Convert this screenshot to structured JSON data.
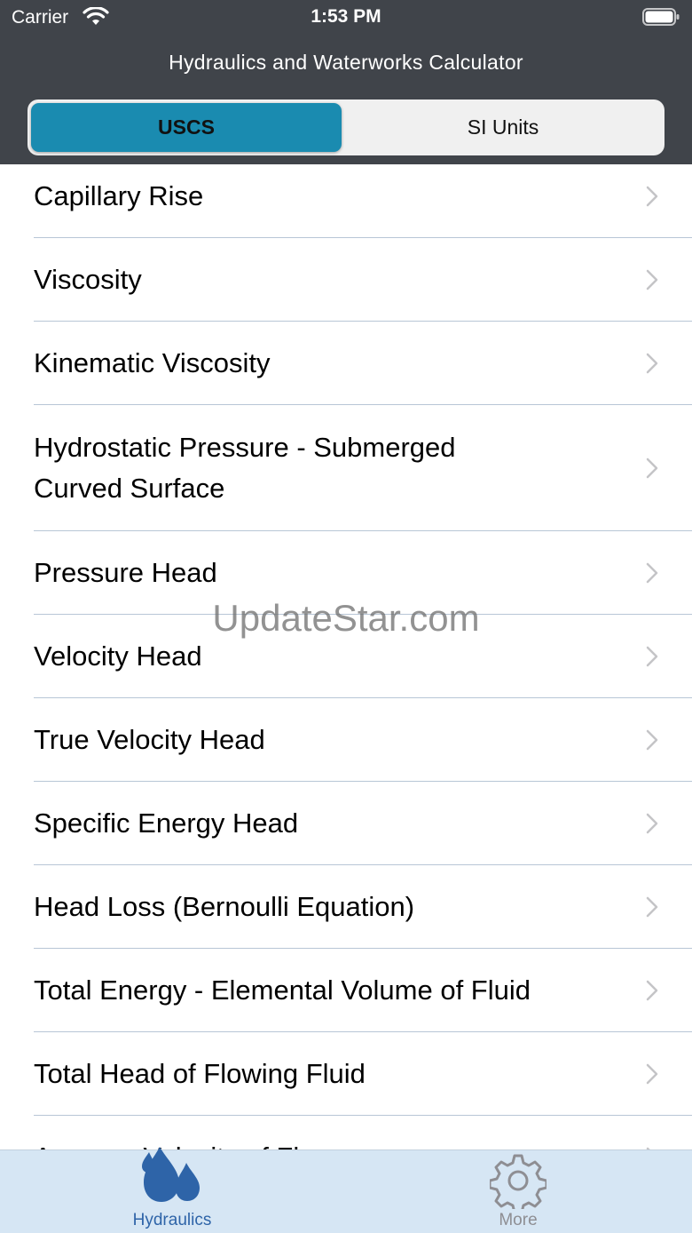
{
  "status_bar": {
    "carrier": "Carrier",
    "time": "1:53 PM"
  },
  "nav": {
    "title": "Hydraulics and Waterworks Calculator"
  },
  "segmented": {
    "options": [
      "USCS",
      "SI Units"
    ],
    "selected": "USCS"
  },
  "list": {
    "items": [
      {
        "label": "Capillary Rise"
      },
      {
        "label": "Viscosity"
      },
      {
        "label": "Kinematic Viscosity"
      },
      {
        "label": "Hydrostatic Pressure - Submerged Curved Surface"
      },
      {
        "label": "Pressure Head"
      },
      {
        "label": "Velocity Head"
      },
      {
        "label": "True Velocity Head"
      },
      {
        "label": "Specific Energy Head"
      },
      {
        "label": "Head Loss (Bernoulli Equation)"
      },
      {
        "label": "Total Energy - Elemental Volume of Fluid"
      },
      {
        "label": "Total Head of Flowing Fluid"
      },
      {
        "label": "Average Velocity of Flow"
      }
    ]
  },
  "watermark": "UpdateStar.com",
  "tab_bar": {
    "tabs": [
      {
        "label": "Hydraulics",
        "icon": "water-drops-icon",
        "selected": true
      },
      {
        "label": "More",
        "icon": "gear-icon",
        "selected": false
      }
    ]
  },
  "colors": {
    "header_bg": "#40444a",
    "segment_selected": "#1a8bb0",
    "tab_bar_bg": "#d6e6f4",
    "tab_active": "#2e64a8",
    "tab_inactive": "#8e8e93"
  }
}
